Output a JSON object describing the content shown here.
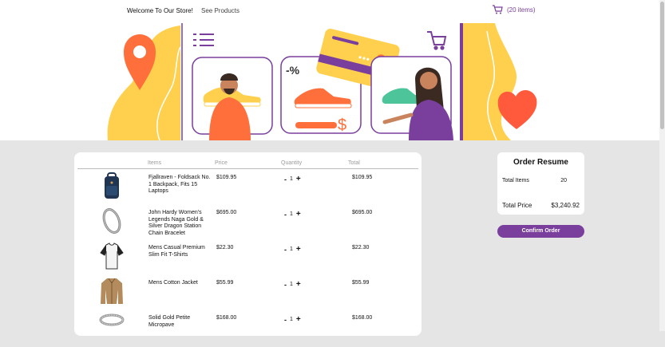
{
  "header": {
    "welcome": "Welcome To Our Store!",
    "see_products": "See Products",
    "cart_label": "(20 items)"
  },
  "table": {
    "headers": [
      "Items",
      "Price",
      "Quantity",
      "Total"
    ],
    "rows": [
      {
        "name": "Fjallraven - Foldsack No. 1 Backpack, Fits 15 Laptops",
        "price": "$109.95",
        "qty": "1",
        "total": "$109.95",
        "icon": "backpack-icon"
      },
      {
        "name": "John Hardy Women's Legends Naga Gold & Silver Dragon Station Chain Bracelet",
        "price": "$695.00",
        "qty": "1",
        "total": "$695.00",
        "icon": "bracelet-icon"
      },
      {
        "name": "Mens Casual Premium Slim Fit T-Shirts",
        "price": "$22.30",
        "qty": "1",
        "total": "$22.30",
        "icon": "tshirt-icon"
      },
      {
        "name": "Mens Cotton Jacket",
        "price": "$55.99",
        "qty": "1",
        "total": "$55.99",
        "icon": "jacket-icon"
      },
      {
        "name": "Solid Gold Petite Micropave",
        "price": "$168.00",
        "qty": "1",
        "total": "$168.00",
        "icon": "ring-icon"
      }
    ],
    "minus_label": "-",
    "plus_label": "+"
  },
  "resume": {
    "title": "Order Resume",
    "total_items_label": "Total Items",
    "total_items_value": "20",
    "total_price_label": "Total Price",
    "total_price_value": "$3,240.92",
    "confirm_label": "Confirm Order"
  },
  "colors": {
    "accent": "#7a3f9d",
    "yellow": "#ffd04d",
    "orange": "#ff6f3c",
    "background": "#e5e5e5"
  }
}
